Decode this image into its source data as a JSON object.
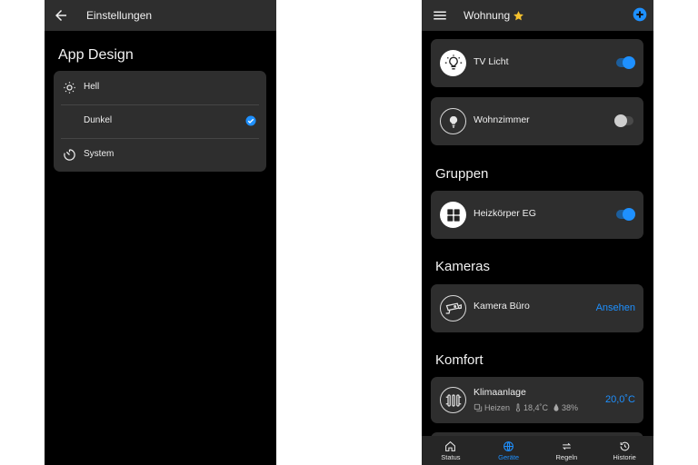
{
  "settings": {
    "title": "Einstellungen",
    "section_title": "App Design",
    "options": [
      {
        "label": "Hell",
        "icon": "sun-icon",
        "selected": false
      },
      {
        "label": "Dunkel",
        "icon": "moon-icon",
        "selected": true
      },
      {
        "label": "System",
        "icon": "timer-icon",
        "selected": false
      }
    ]
  },
  "home": {
    "title": "Wohnung",
    "title_icon": "star-icon",
    "devices": [
      {
        "name": "TV Licht",
        "icon": "lightbulb-on-icon",
        "on": true
      },
      {
        "name": "Wohnzimmer",
        "icon": "lightbulb-off-icon",
        "on": false
      }
    ],
    "groups": {
      "title": "Gruppen",
      "items": [
        {
          "name": "Heizkörper EG",
          "icon": "grid-icon",
          "on": true
        }
      ]
    },
    "cameras": {
      "title": "Kameras",
      "items": [
        {
          "name": "Kamera Büro",
          "icon": "camera-icon",
          "action": "Ansehen"
        }
      ]
    },
    "comfort": {
      "title": "Komfort",
      "items": [
        {
          "name": "Klimaanlage",
          "icon": "radiator-icon",
          "mode": "Heizen",
          "current_temp": "18,4˚C",
          "humidity": "38%",
          "target_temp": "20,0˚C"
        }
      ]
    },
    "nav": [
      {
        "label": "Status",
        "icon": "home-icon",
        "active": false
      },
      {
        "label": "Geräte",
        "icon": "globe-icon",
        "active": true
      },
      {
        "label": "Regeln",
        "icon": "repeat-icon",
        "active": false
      },
      {
        "label": "Historie",
        "icon": "history-icon",
        "active": false
      }
    ]
  },
  "colors": {
    "accent": "#1e90ff",
    "card": "#2e2e2e",
    "appbar": "#2e2e2e",
    "background": "#000000"
  }
}
